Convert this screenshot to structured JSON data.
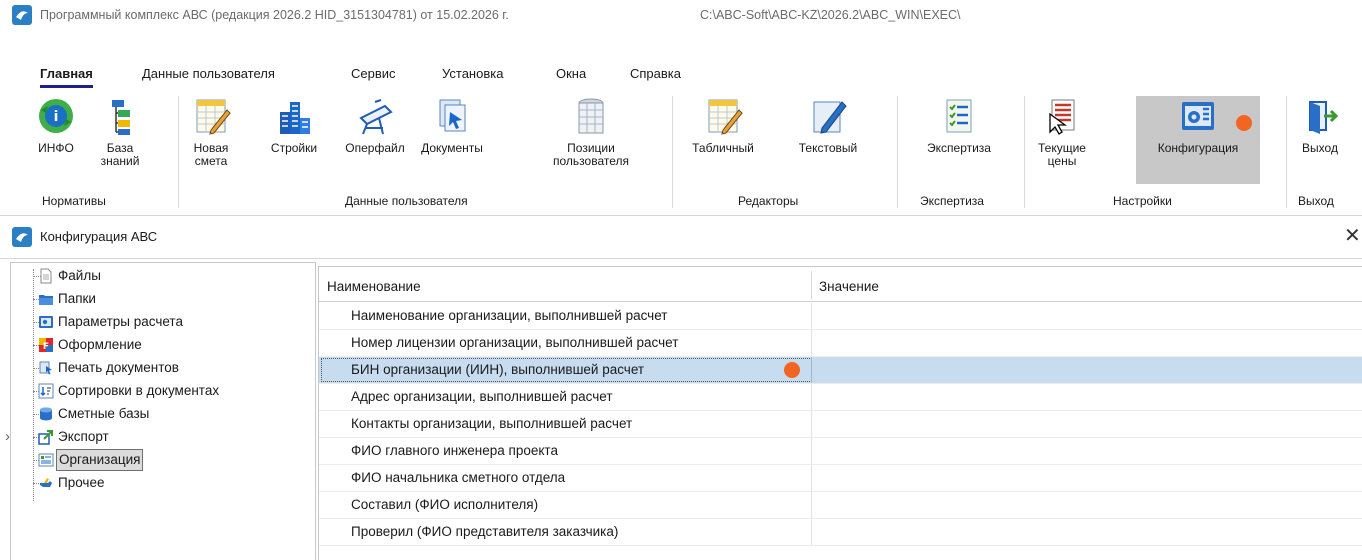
{
  "window": {
    "title": "Программный комплекс АВС (редакция 2026.2 HID_3151304781) от 15.02.2026 г.",
    "path": "C:\\ABC-Soft\\ABC-KZ\\2026.2\\ABC_WIN\\EXEC\\"
  },
  "menu": [
    {
      "label": "Главная",
      "active": true
    },
    {
      "label": "Данные пользователя"
    },
    {
      "label": "Сервис"
    },
    {
      "label": "Установка"
    },
    {
      "label": "Окна"
    },
    {
      "label": "Справка"
    }
  ],
  "ribbon": {
    "tools": {
      "info": "ИНФО",
      "kb": "База\nзнаний",
      "new_estimate": "Новая\nсмета",
      "buildings": "Стройки",
      "operfile": "Оперфайл",
      "documents": "Документы",
      "user_positions": "Позиции\nпользователя",
      "table_editor": "Табличный",
      "text_editor": "Текстовый",
      "expertise": "Экспертиза",
      "current_prices": "Текущие\nцены",
      "configuration": "Конфигурация",
      "exit": "Выход"
    },
    "groups": {
      "normatives": "Нормативы",
      "user_data": "Данные пользователя",
      "editors": "Редакторы",
      "expertise": "Экспертиза",
      "settings": "Настройки",
      "exit": "Выход"
    }
  },
  "config_window": {
    "title": "Конфигурация АВС",
    "close_glyph": "✕"
  },
  "tree": [
    {
      "label": "Файлы",
      "icon": "file-icon"
    },
    {
      "label": "Папки",
      "icon": "folder-icon"
    },
    {
      "label": "Параметры расчета",
      "icon": "calculator-icon"
    },
    {
      "label": "Оформление",
      "icon": "format-icon"
    },
    {
      "label": "Печать документов",
      "icon": "print-icon"
    },
    {
      "label": "Сортировки в документах",
      "icon": "sort-icon"
    },
    {
      "label": "Сметные базы",
      "icon": "database-icon"
    },
    {
      "label": "Экспорт",
      "icon": "export-icon",
      "expandable": true
    },
    {
      "label": "Организация",
      "icon": "organization-icon",
      "selected": true
    },
    {
      "label": "Прочее",
      "icon": "pointer-hand-icon"
    }
  ],
  "tree_expander": "›",
  "grid": {
    "columns": [
      "Наименование",
      "Значение"
    ],
    "rows": [
      {
        "name": "Наименование организации, выполнившей расчет",
        "value": ""
      },
      {
        "name": "Номер лицензии организации, выполнившей расчет",
        "value": ""
      },
      {
        "name": "БИН организации (ИИН), выполнившей расчет",
        "value": "",
        "selected": true
      },
      {
        "name": "Адрес организации, выполнившей расчет",
        "value": ""
      },
      {
        "name": "Контакты организации, выполнившей расчет",
        "value": ""
      },
      {
        "name": "ФИО главного инженера проекта",
        "value": ""
      },
      {
        "name": "ФИО начальника сметного отдела",
        "value": ""
      },
      {
        "name": "Составил (ФИО исполнителя)",
        "value": ""
      },
      {
        "name": "Проверил (ФИО представителя заказчика)",
        "value": ""
      }
    ]
  },
  "colors": {
    "accent_dot": "#f26522",
    "selection": "#c7dcef",
    "menu_underline": "#1f1f8f"
  }
}
